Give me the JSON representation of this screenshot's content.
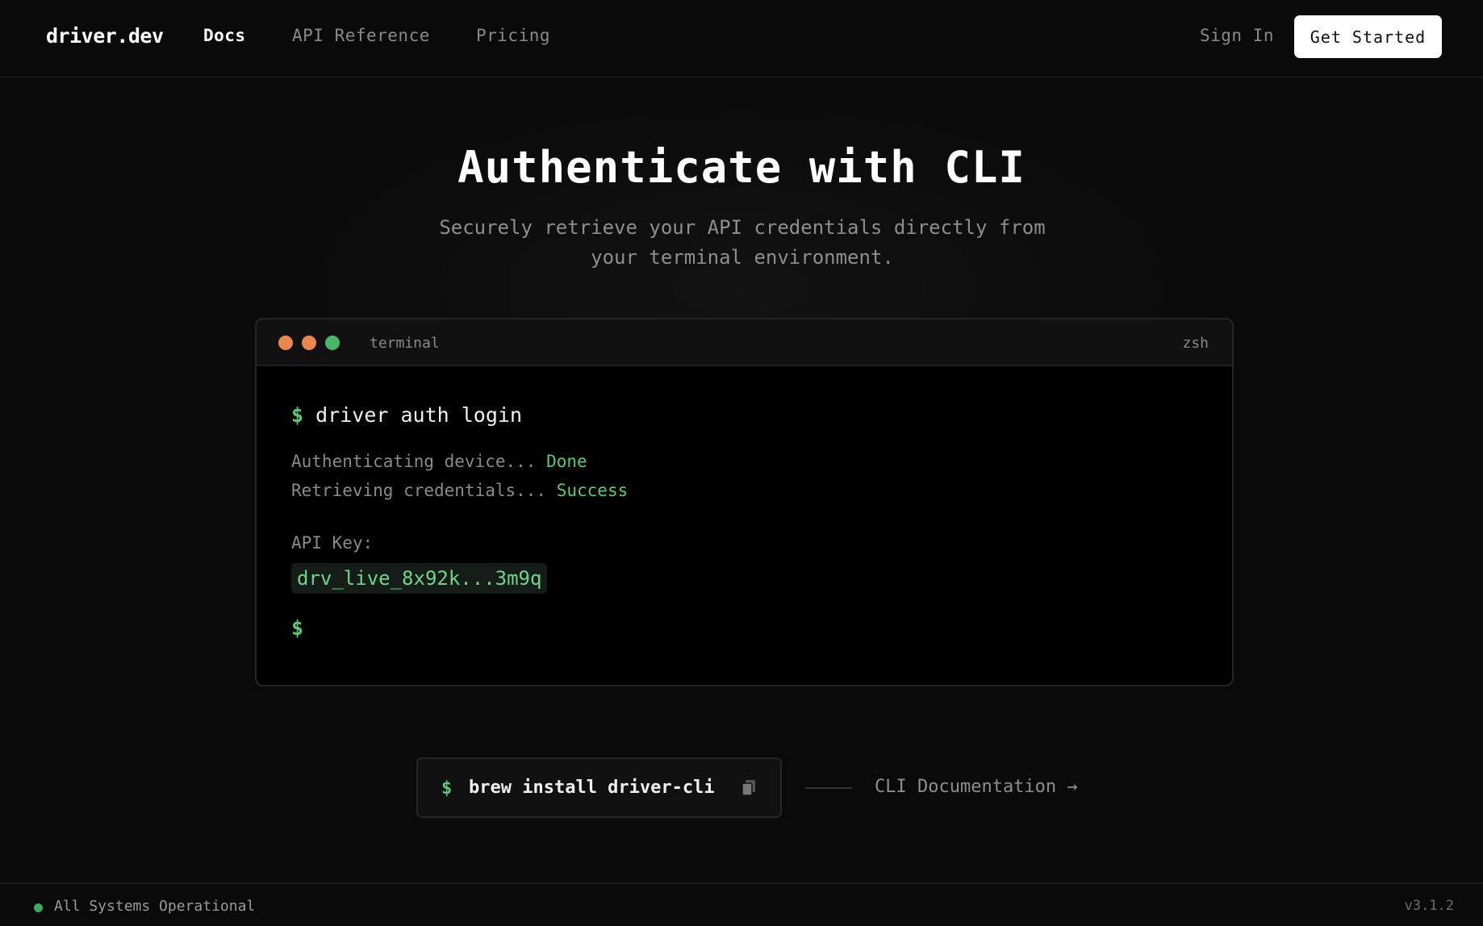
{
  "header": {
    "logo": "driver.dev",
    "nav": {
      "docs": "Docs",
      "api_reference": "API Reference",
      "pricing": "Pricing"
    },
    "sign_in": "Sign In",
    "get_started": "Get Started"
  },
  "hero": {
    "title": "Authenticate with CLI",
    "subtitle": "Securely retrieve your API credentials directly from your terminal environment."
  },
  "terminal": {
    "title": "terminal",
    "shell": "zsh",
    "prompt": "$",
    "command": "driver auth login",
    "line1_text": "Authenticating device...",
    "line1_status": "Done",
    "line2_text": "Retrieving credentials...",
    "line2_status": "Success",
    "api_key_label": "API Key:",
    "api_key_value": "drv_live_8x92k...3m9q",
    "final_prompt": "$"
  },
  "install": {
    "prompt": "$",
    "command": "brew install driver-cli",
    "copy_icon": "copy-icon"
  },
  "doc_link": {
    "label": "CLI Documentation →"
  },
  "footer": {
    "status": "All Systems Operational",
    "version": "v3.1.2"
  },
  "colors": {
    "accent_green": "#5cc878",
    "traffic_orange": "#e8884f",
    "traffic_green": "#4bb56a"
  }
}
